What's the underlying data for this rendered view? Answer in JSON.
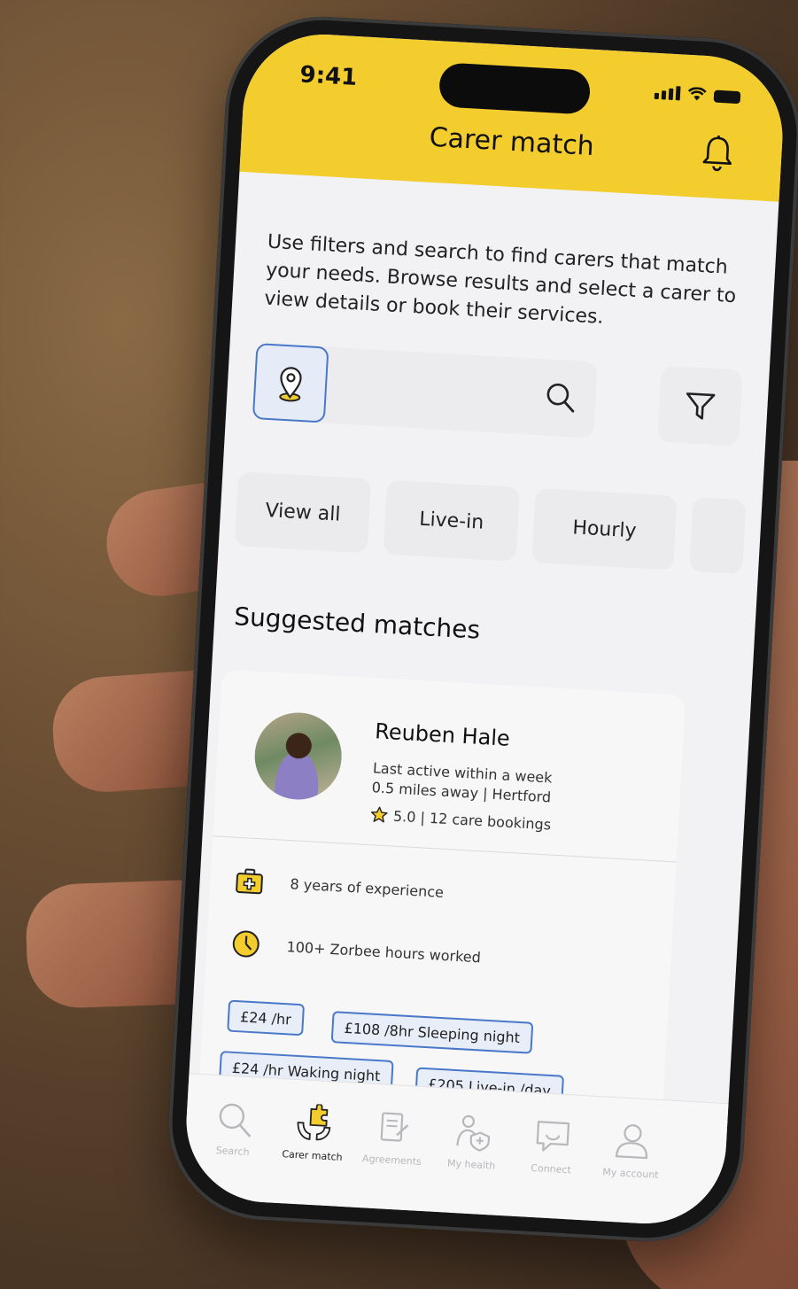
{
  "status": {
    "time": "9:41"
  },
  "header": {
    "title": "Carer match"
  },
  "intro": "Use filters and search to find carers that match your needs. Browse results and select a carer to view details or book their services.",
  "search": {
    "placeholder": ""
  },
  "chips": [
    {
      "label": "View all"
    },
    {
      "label": "Live-in"
    },
    {
      "label": "Hourly"
    }
  ],
  "section_title": "Suggested matches",
  "carer": {
    "name": "Reuben Hale",
    "last_active": "Last active within a week",
    "distance": "0.5 miles away | Hertford",
    "rating": "5.0 | 12 care bookings",
    "experience": "8 years of experience",
    "hours": "100+ Zorbee hours worked",
    "rates": [
      "£24 /hr",
      "£108 /8hr Sleeping night",
      "£24 /hr  Waking night",
      "£205 Live-in /day"
    ]
  },
  "tabs": [
    {
      "label": "Search",
      "icon": "search-icon"
    },
    {
      "label": "Carer match",
      "icon": "carer-match-icon"
    },
    {
      "label": "Agreements",
      "icon": "agreements-icon"
    },
    {
      "label": "My health",
      "icon": "my-health-icon"
    },
    {
      "label": "Connect",
      "icon": "chat-icon"
    },
    {
      "label": "My account",
      "icon": "account-icon"
    }
  ],
  "colors": {
    "header": "#f3cc2e",
    "accent_blue": "#4a78c8",
    "icon_yellow": "#f3cc2e"
  }
}
